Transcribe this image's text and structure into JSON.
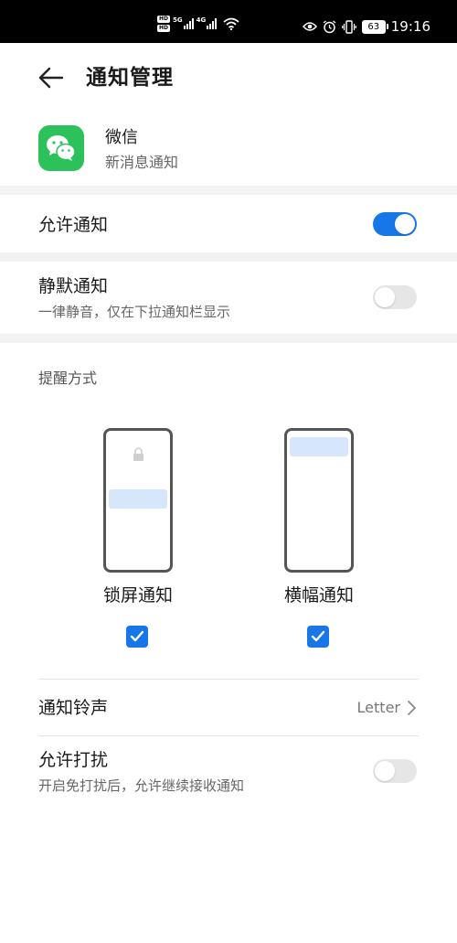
{
  "status_bar": {
    "hd1": "HD",
    "hd2": "HD",
    "net1": "5G",
    "net2": "4G",
    "battery": "63",
    "time": "19:16"
  },
  "header": {
    "title": "通知管理"
  },
  "app": {
    "name": "微信",
    "subtitle": "新消息通知",
    "icon_color": "#2dc15b"
  },
  "settings": {
    "allow_notifications": {
      "label": "允许通知",
      "enabled": true
    },
    "silent_notifications": {
      "label": "静默通知",
      "description": "一律静音，仅在下拉通知栏显示",
      "enabled": false
    }
  },
  "reminder": {
    "section_label": "提醒方式",
    "modes": [
      {
        "label": "锁屏通知",
        "checked": true
      },
      {
        "label": "横幅通知",
        "checked": true
      }
    ]
  },
  "ringtone": {
    "label": "通知铃声",
    "value": "Letter"
  },
  "dnd": {
    "label": "允许打扰",
    "description": "开启免打扰后，允许继续接收通知",
    "enabled": false
  },
  "colors": {
    "accent": "#1777e8",
    "toggle_off": "#e6e6e6",
    "band": "#f2f2f2"
  }
}
